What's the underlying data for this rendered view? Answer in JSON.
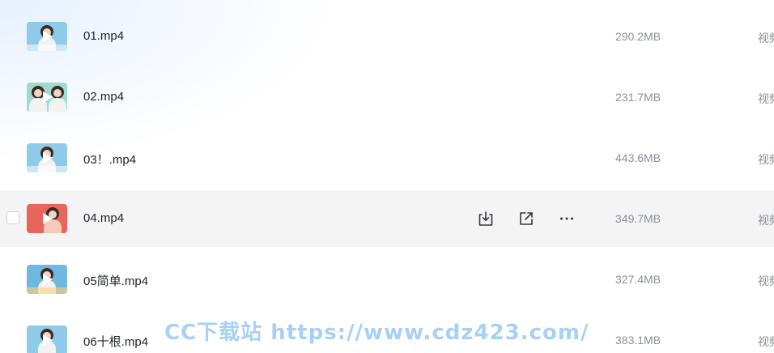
{
  "files": [
    {
      "name": "01.mp4",
      "size": "290.2MB",
      "type": "视频",
      "thumb_bg": "#8fcbe8"
    },
    {
      "name": "02.mp4",
      "size": "231.7MB",
      "type": "视频",
      "thumb_bg": "#9fd9cf"
    },
    {
      "name": "03！.mp4",
      "size": "443.6MB",
      "type": "视频",
      "thumb_bg": "#8fcbe8"
    },
    {
      "name": "04.mp4",
      "size": "349.7MB",
      "type": "视频",
      "thumb_bg": "#e8655d"
    },
    {
      "name": "05简单.mp4",
      "size": "327.4MB",
      "type": "视频",
      "thumb_bg": "#6fb9e0"
    },
    {
      "name": "06十根.mp4",
      "size": "383.1MB",
      "type": "视频",
      "thumb_bg": "#8fcbe8"
    }
  ],
  "hovered_row": 3,
  "row_actions": [
    "download-icon",
    "share-icon",
    "more-icon"
  ],
  "watermark": "CC下载站 https://www.cdz423.com/",
  "colors": {
    "hover_bg": "#f4f4f5",
    "text": "#1f2329",
    "muted": "#8a8f99",
    "watermark": "#60aaf0"
  }
}
